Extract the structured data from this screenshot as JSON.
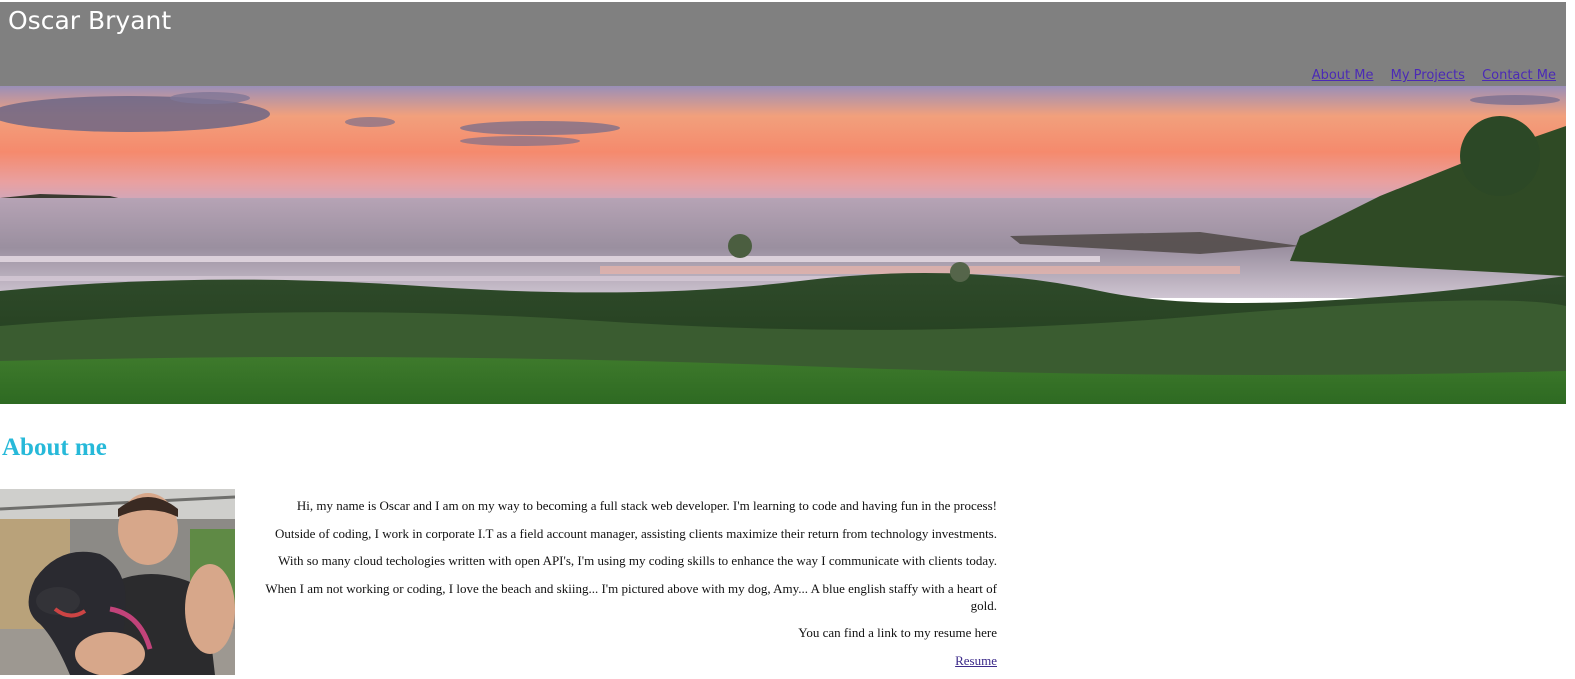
{
  "header": {
    "title": "Oscar Bryant",
    "nav": [
      {
        "label": "About Me"
      },
      {
        "label": "My Projects"
      },
      {
        "label": "Contact Me"
      }
    ],
    "background_color": "#808080",
    "link_color": "#4b2ab6"
  },
  "hero": {
    "image": "sunset-beach-banner"
  },
  "about": {
    "heading": "About me",
    "heading_color": "#27b9d9",
    "photo": "photo-of-man-with-dog",
    "paragraphs": [
      "Hi, my name is Oscar and I am on my way to becoming a full stack web developer. I'm learning to code and having fun in the process!",
      "Outside of coding, I work in corporate I.T as a field account manager, assisting clients maximize their return from technology investments.",
      "With so many cloud techologies written with open API's, I'm using my coding skills to enhance the way I communicate with clients today.",
      "When I am not working or coding, I love the beach and skiing... I'm pictured above with my dog, Amy... A blue english staffy with a heart of gold.",
      "You can find a link to my resume here"
    ],
    "resume_link": "Resume"
  }
}
